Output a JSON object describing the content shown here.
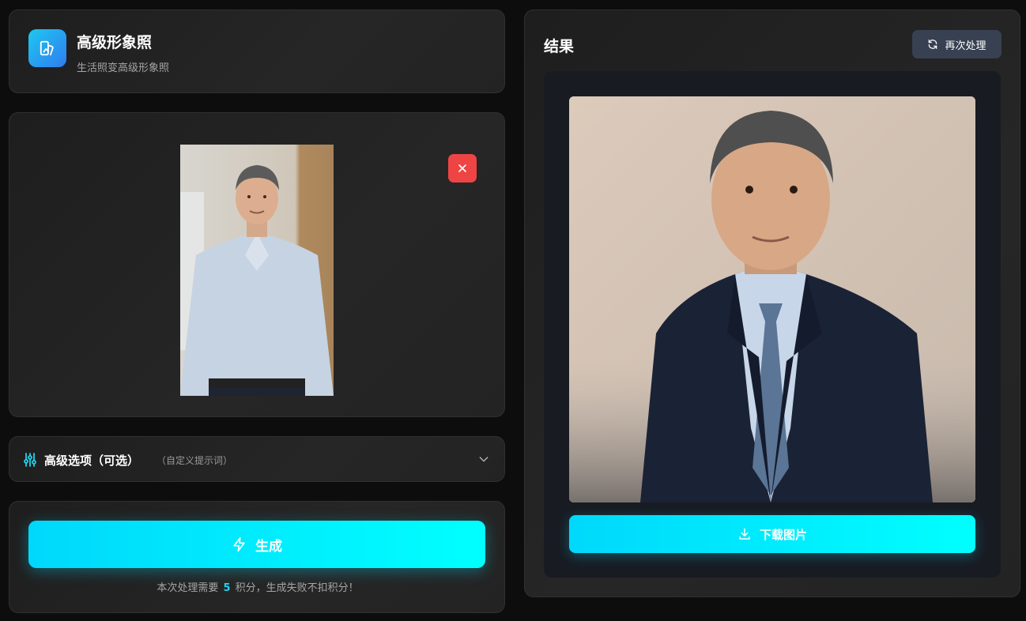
{
  "app": {
    "title": "高级形象照",
    "subtitle": "生活照变高级形象照",
    "icon": "image-edit-icon",
    "accent_color": "#22d3ee"
  },
  "upload": {
    "photo_icon": "uploaded-portrait-photo",
    "remove_icon": "close-icon",
    "remove_color": "#ef4444"
  },
  "options": {
    "icon": "sliders-icon",
    "label": "高级选项（可选）",
    "hint": "（自定义提示词）",
    "chevron_icon": "chevron-down-icon"
  },
  "generate": {
    "icon": "lightning-icon",
    "label": "生成",
    "cost_prefix": "本次处理需要",
    "cost_value": "5",
    "cost_suffix": "积分，生成失败不扣积分！"
  },
  "result": {
    "title": "结果",
    "reprocess_icon": "refresh-icon",
    "reprocess_label": "再次处理",
    "photo_icon": "result-portrait-photo",
    "download_icon": "download-icon",
    "download_label": "下载图片"
  }
}
